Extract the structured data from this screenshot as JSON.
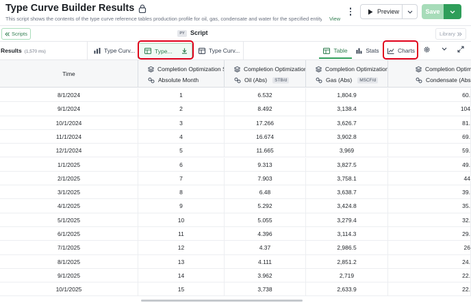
{
  "header": {
    "title": "Type Curve Builder Results",
    "description": "This script shows the contents of the type curve reference tables production profile for oil, gas, condensate and water for the specified entity. To u...",
    "view_link": "View",
    "preview_label": "Preview",
    "save_label": "Save"
  },
  "scriptbar": {
    "scripts_label": "Scripts",
    "script_badge": "PY",
    "script_label": "Script",
    "library_label": "Library"
  },
  "toolbar": {
    "results_label": "Results",
    "results_time": "(1,570 ms)",
    "tabs": [
      {
        "label": "Type Curv..."
      },
      {
        "label": "Type..."
      },
      {
        "label": "Type Curv..."
      }
    ],
    "views": {
      "table": "Table",
      "stats": "Stats",
      "charts": "Charts"
    }
  },
  "colors": {
    "accent": "#2f9e5a",
    "accent_light": "#a7dcb9",
    "highlight": "#e0001a"
  },
  "table": {
    "columns": [
      {
        "group": "",
        "label": "Time",
        "unit": ""
      },
      {
        "group": "Completion Optimization S",
        "label": "Absolute Month",
        "unit": ""
      },
      {
        "group": "Completion Optimization",
        "label": "Oil (Abs)",
        "unit": "STB/d"
      },
      {
        "group": "Completion Optimization",
        "label": "Gas (Abs)",
        "unit": "MSCF/d"
      },
      {
        "group": "Completion Optimi",
        "label": "Condensate (Abs",
        "unit": ""
      }
    ],
    "rows": [
      {
        "time": "8/1/2024",
        "month": "1",
        "oil": "6.532",
        "gas": "1,804.9",
        "cond": "60."
      },
      {
        "time": "9/1/2024",
        "month": "2",
        "oil": "8.492",
        "gas": "3,138.4",
        "cond": "104"
      },
      {
        "time": "10/1/2024",
        "month": "3",
        "oil": "17.266",
        "gas": "3,626.7",
        "cond": "81."
      },
      {
        "time": "11/1/2024",
        "month": "4",
        "oil": "16.674",
        "gas": "3,902.8",
        "cond": "69."
      },
      {
        "time": "12/1/2024",
        "month": "5",
        "oil": "11.665",
        "gas": "3,969",
        "cond": "59."
      },
      {
        "time": "1/1/2025",
        "month": "6",
        "oil": "9.313",
        "gas": "3,827.5",
        "cond": "49."
      },
      {
        "time": "2/1/2025",
        "month": "7",
        "oil": "7.903",
        "gas": "3,758.1",
        "cond": "44"
      },
      {
        "time": "3/1/2025",
        "month": "8",
        "oil": "6.48",
        "gas": "3,638.7",
        "cond": "39."
      },
      {
        "time": "4/1/2025",
        "month": "9",
        "oil": "5.292",
        "gas": "3,424.8",
        "cond": "35."
      },
      {
        "time": "5/1/2025",
        "month": "10",
        "oil": "5.055",
        "gas": "3,279.4",
        "cond": "32."
      },
      {
        "time": "6/1/2025",
        "month": "11",
        "oil": "4.396",
        "gas": "3,114.3",
        "cond": "29."
      },
      {
        "time": "7/1/2025",
        "month": "12",
        "oil": "4.37",
        "gas": "2,986.5",
        "cond": "26"
      },
      {
        "time": "8/1/2025",
        "month": "13",
        "oil": "4.111",
        "gas": "2,851.2",
        "cond": "24."
      },
      {
        "time": "9/1/2025",
        "month": "14",
        "oil": "3.962",
        "gas": "2,719",
        "cond": "22."
      },
      {
        "time": "10/1/2025",
        "month": "15",
        "oil": "3,738",
        "gas": "2,633.9",
        "cond": "22."
      }
    ]
  }
}
